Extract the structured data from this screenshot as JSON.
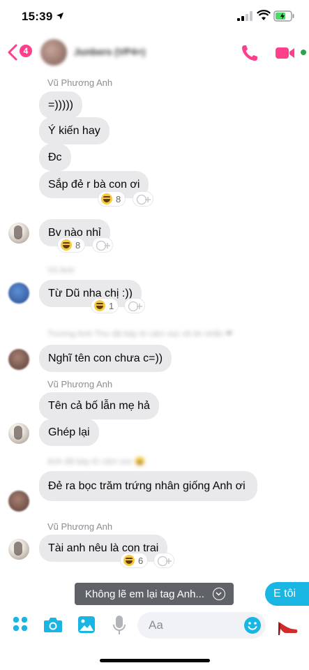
{
  "status_bar": {
    "time": "15:39"
  },
  "header": {
    "back_badge": "4",
    "contact_name": "Junbers (VP4+)"
  },
  "messages": {
    "sender_1": "Vũ Phương Anh",
    "m1": "=)))))",
    "m2": "Ý kiến hay",
    "m3": "Đc",
    "m4": "Sắp đẻ r bà con ơi",
    "m4_react_count": "8",
    "m5": "Bv nào nhỉ",
    "m5_react_count": "8",
    "meta_1": "Vũ Anh",
    "m6": "Từ Dũ nha chị :))",
    "m6_react_count": "1",
    "meta_2": "Trương Anh Thư đã bày tỏ cảm xúc về tin nhắn ❤",
    "m7": "Nghĩ tên con chưa c=))",
    "sender_2": "Vũ Phương Anh",
    "m8": "Tên cả bố lẫn mẹ hả",
    "m9": "Ghép lại",
    "meta_3": "Anh đã bày tỏ cảm xúc 😄",
    "m10": "Đẻ ra bọc trăm trứng nhân giống Anh ơi",
    "sender_3": "Vũ Phương Anh",
    "m11": "Tài anh nêu là con trai",
    "m11_react_count": "6"
  },
  "tag_suggestion": "Không lẽ em lại tag Anh...",
  "quick_reply": "E tôi",
  "composer": {
    "placeholder": "Aa"
  },
  "colors": {
    "accent_pink": "#ff3e8c",
    "bubble_gray": "#e9e9eb",
    "quick_reply_blue": "#19b5e3"
  },
  "icons": [
    "back-chevron-icon",
    "phone-icon",
    "video-camera-icon",
    "apps-icon",
    "camera-icon",
    "gallery-icon",
    "microphone-icon",
    "smile-emoji-icon",
    "high-heel-icon"
  ]
}
